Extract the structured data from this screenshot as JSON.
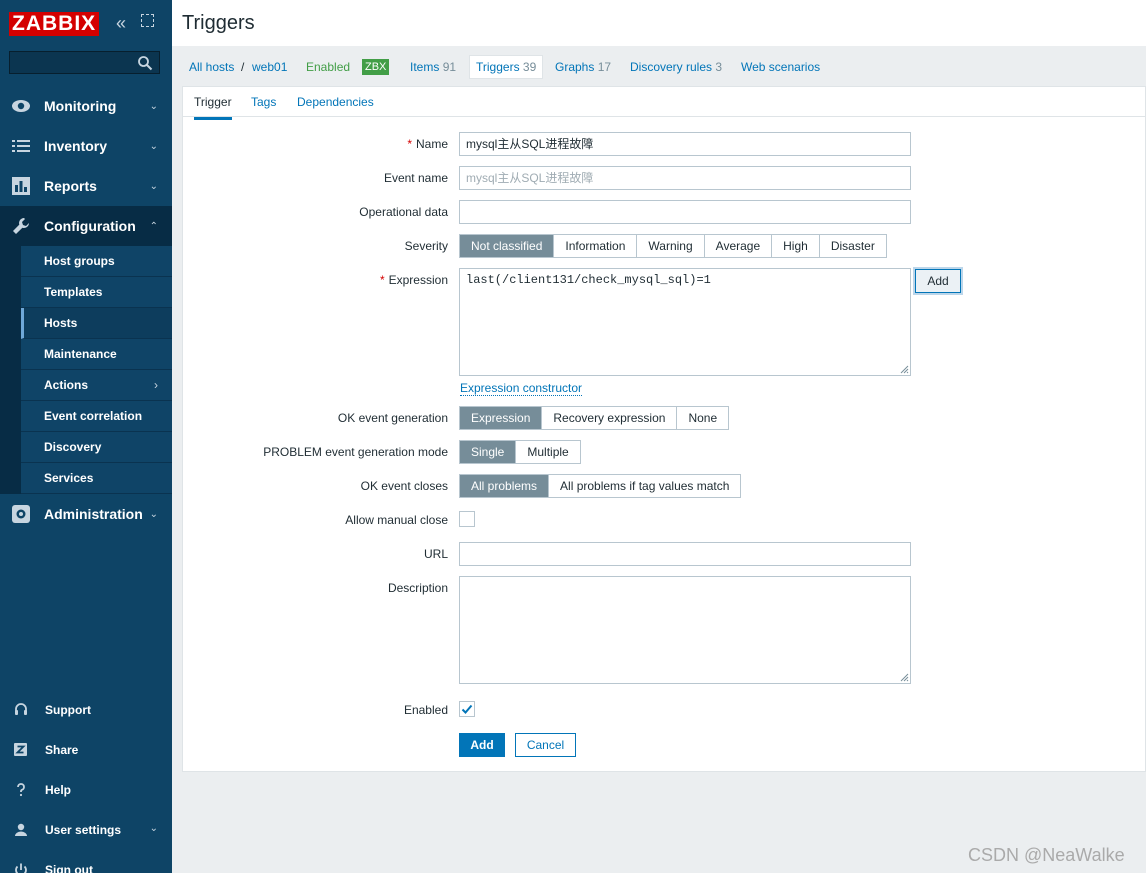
{
  "app": {
    "logo": "ZABBIX",
    "page_title": "Triggers",
    "watermark": "CSDN @NeaWalke"
  },
  "sidebar": {
    "menu": [
      {
        "label": "Monitoring",
        "icon": "eye-icon"
      },
      {
        "label": "Inventory",
        "icon": "list-icon"
      },
      {
        "label": "Reports",
        "icon": "bar-chart-icon"
      },
      {
        "label": "Configuration",
        "icon": "wrench-icon"
      },
      {
        "label": "Administration",
        "icon": "gear-icon"
      }
    ],
    "config_items": [
      {
        "label": "Host groups"
      },
      {
        "label": "Templates"
      },
      {
        "label": "Hosts"
      },
      {
        "label": "Maintenance"
      },
      {
        "label": "Actions"
      },
      {
        "label": "Event correlation"
      },
      {
        "label": "Discovery"
      },
      {
        "label": "Services"
      }
    ],
    "bottom": [
      {
        "label": "Support",
        "icon": "headset-icon"
      },
      {
        "label": "Share",
        "icon": "share-icon"
      },
      {
        "label": "Help",
        "icon": "help-icon"
      },
      {
        "label": "User settings",
        "icon": "user-icon"
      },
      {
        "label": "Sign out",
        "icon": "power-icon"
      }
    ]
  },
  "breadcrumb": {
    "all_hosts": "All hosts",
    "separator": "/",
    "host": "web01",
    "enabled": "Enabled",
    "zbx": "ZBX",
    "items": "Items",
    "items_count": "91",
    "triggers": "Triggers",
    "triggers_count": "39",
    "graphs": "Graphs",
    "graphs_count": "17",
    "discovery": "Discovery rules",
    "discovery_count": "3",
    "web": "Web scenarios"
  },
  "tabs": {
    "trigger": "Trigger",
    "tags": "Tags",
    "dependencies": "Dependencies"
  },
  "form": {
    "required_mark": "*",
    "name_label": "Name",
    "name_value": "mysql主从SQL进程故障",
    "event_name_label": "Event name",
    "event_name_placeholder": "mysql主从SQL进程故障",
    "opdata_label": "Operational data",
    "opdata_value": "",
    "severity_label": "Severity",
    "severity_options": [
      "Not classified",
      "Information",
      "Warning",
      "Average",
      "High",
      "Disaster"
    ],
    "severity_selected": "Not classified",
    "expression_label": "Expression",
    "expression_value": "last(/client131/check_mysql_sql)=1",
    "expression_add": "Add",
    "expression_constructor": "Expression constructor",
    "ok_gen_label": "OK event generation",
    "ok_gen_options": [
      "Expression",
      "Recovery expression",
      "None"
    ],
    "ok_gen_selected": "Expression",
    "problem_mode_label": "PROBLEM event generation mode",
    "problem_mode_options": [
      "Single",
      "Multiple"
    ],
    "problem_mode_selected": "Single",
    "ok_closes_label": "OK event closes",
    "ok_closes_options": [
      "All problems",
      "All problems if tag values match"
    ],
    "ok_closes_selected": "All problems",
    "manual_close_label": "Allow manual close",
    "manual_close_checked": false,
    "url_label": "URL",
    "url_value": "",
    "description_label": "Description",
    "description_value": "",
    "enabled_label": "Enabled",
    "enabled_checked": true,
    "submit": "Add",
    "cancel": "Cancel"
  }
}
